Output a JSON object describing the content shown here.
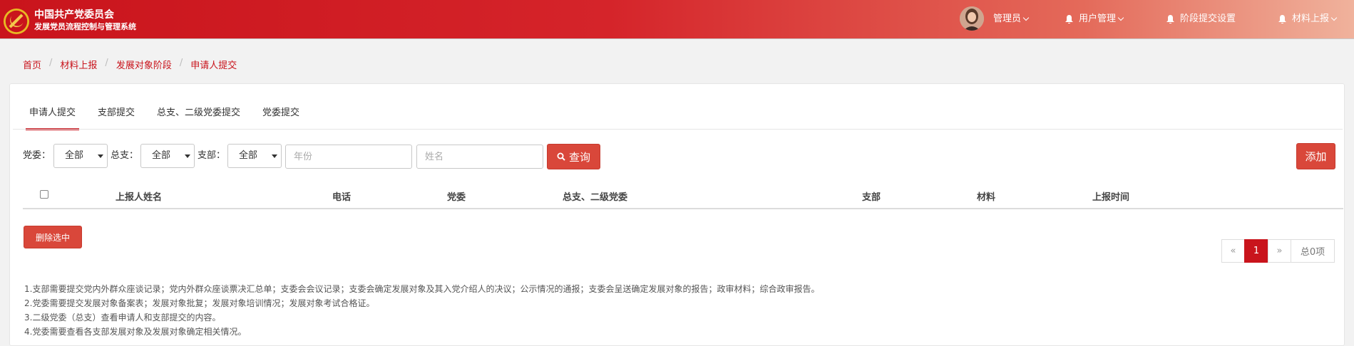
{
  "header": {
    "title_line1": "中国共产党委员会",
    "title_line2": "发展党员流程控制与管理系统",
    "nav": {
      "admin": "管理员",
      "user_mgmt": "用户管理",
      "stage_settings": "阶段提交设置",
      "material_upload": "材料上报"
    },
    "colors": {
      "primary": "#c9141c",
      "gradient_end": "#f0b29c"
    }
  },
  "breadcrumb": [
    "首页",
    "材料上报",
    "发展对象阶段",
    "申请人提交"
  ],
  "tabs": [
    "申请人提交",
    "支部提交",
    "总支、二级党委提交",
    "党委提交"
  ],
  "active_tab": "申请人提交",
  "filters": {
    "party_committee_label": "党委：",
    "general_branch_label": "总支：",
    "branch_label": "支部：",
    "select_all": "全部",
    "year_placeholder": "年份",
    "name_placeholder": "姓名",
    "search_label": "查询",
    "add_label": "添加"
  },
  "table": {
    "columns": [
      "上报人姓名",
      "电话",
      "党委",
      "总支、二级党委",
      "支部",
      "材料",
      "上报时间"
    ],
    "rows": []
  },
  "delete_selected_label": "删除选中",
  "pagination": {
    "prev": "«",
    "current": "1",
    "next": "»",
    "total": "总0项"
  },
  "notes": [
    "1.支部需要提交党内外群众座谈记录；党内外群众座谈票决汇总单；支委会会议记录；支委会确定发展对象及其入党介绍人的决议；公示情况的通报；支委会呈送确定发展对象的报告；政审材料；综合政审报告。",
    "2.党委需要提交发展对象备案表；发展对象批复；发展对象培训情况；发展对象考试合格证。",
    "3.二级党委（总支）查看申请人和支部提交的内容。",
    "4.党委需要查看各支部发展对象及发展对象确定相关情况。"
  ]
}
